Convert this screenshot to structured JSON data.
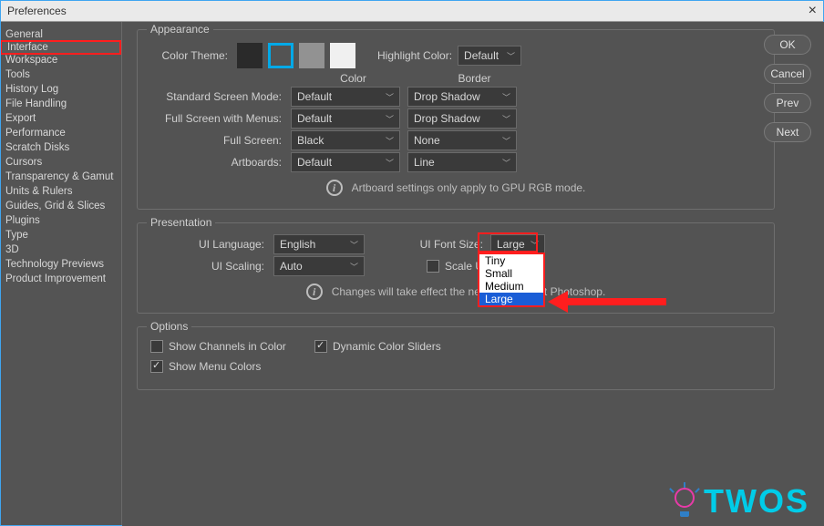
{
  "window": {
    "title": "Preferences"
  },
  "sidebar": {
    "items": [
      "General",
      "Interface",
      "Workspace",
      "Tools",
      "History Log",
      "File Handling",
      "Export",
      "Performance",
      "Scratch Disks",
      "Cursors",
      "Transparency & Gamut",
      "Units & Rulers",
      "Guides, Grid & Slices",
      "Plugins",
      "Type",
      "3D",
      "Technology Previews",
      "Product Improvement"
    ],
    "selected_index": 1
  },
  "buttons": {
    "ok": "OK",
    "cancel": "Cancel",
    "prev": "Prev",
    "next": "Next"
  },
  "appearance": {
    "title": "Appearance",
    "color_theme_label": "Color Theme:",
    "highlight_label": "Highlight Color:",
    "highlight_value": "Default",
    "headers": {
      "color": "Color",
      "border": "Border"
    },
    "rows": {
      "standard": {
        "label": "Standard Screen Mode:",
        "color": "Default",
        "border": "Drop Shadow"
      },
      "menus": {
        "label": "Full Screen with Menus:",
        "color": "Default",
        "border": "Drop Shadow"
      },
      "full": {
        "label": "Full Screen:",
        "color": "Black",
        "border": "None"
      },
      "art": {
        "label": "Artboards:",
        "color": "Default",
        "border": "Line"
      }
    },
    "info": "Artboard settings only apply to GPU RGB mode."
  },
  "presentation": {
    "title": "Presentation",
    "ui_language_label": "UI Language:",
    "ui_language_value": "English",
    "ui_scaling_label": "UI Scaling:",
    "ui_scaling_value": "Auto",
    "ui_font_label": "UI Font Size:",
    "ui_font_value": "Large",
    "ui_font_options": [
      "Tiny",
      "Small",
      "Medium",
      "Large"
    ],
    "ui_font_selected": "Large",
    "scale_label": "Scale U",
    "info": "Changes will take effect the next time you start Photoshop.",
    "info_visible_left": "Changes will take effect the nex",
    "info_visible_right": "t Photoshop."
  },
  "options": {
    "title": "Options",
    "show_channels": {
      "label": "Show Channels in Color",
      "checked": false
    },
    "dynamic_sliders": {
      "label": "Dynamic Color Sliders",
      "checked": true
    },
    "show_menu": {
      "label": "Show Menu Colors",
      "checked": true
    }
  },
  "logo_text": "TWOS"
}
